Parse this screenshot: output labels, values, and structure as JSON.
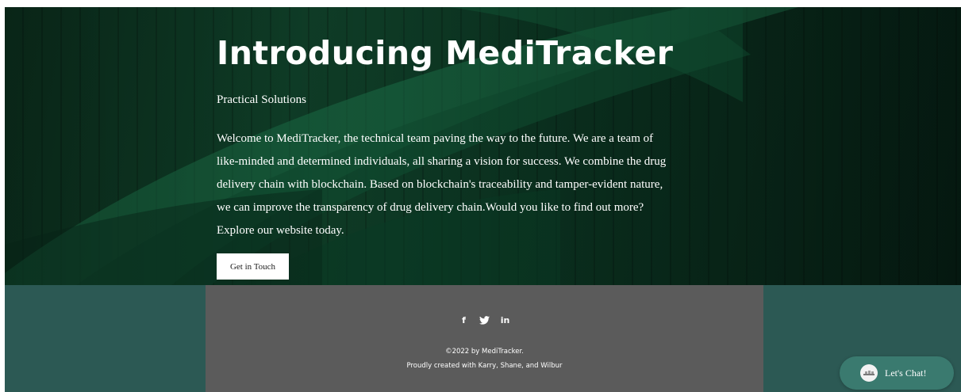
{
  "hero": {
    "title": "Introducing MediTracker",
    "subtitle": "Practical Solutions",
    "body": "Welcome to MediTracker, the technical team paving the way to the future. We are a team of like-minded and determined individuals, all sharing a vision for success. We combine the drug delivery chain with blockchain. Based on blockchain's traceability and tamper-evident nature, we can improve the transparency of drug delivery chain.Would you like to find out more? Explore our website today.",
    "cta_label": "Get in Touch"
  },
  "footer": {
    "social": {
      "facebook_glyph": "f",
      "linkedin_glyph": "in"
    },
    "copyright": "©2022 by MediTracker.",
    "credits": "Proudly created with Karry, Shane, and Wilbur"
  },
  "chat": {
    "label": "Let's Chat!"
  },
  "colors": {
    "hero_dark": "#0b3220",
    "footer_teal": "#2c5954",
    "footer_center": "#5b5b5b",
    "chat_bg": "#3a7a6f"
  },
  "icons": [
    "facebook-icon",
    "twitter-icon",
    "linkedin-icon",
    "chat-avatar-icon"
  ]
}
